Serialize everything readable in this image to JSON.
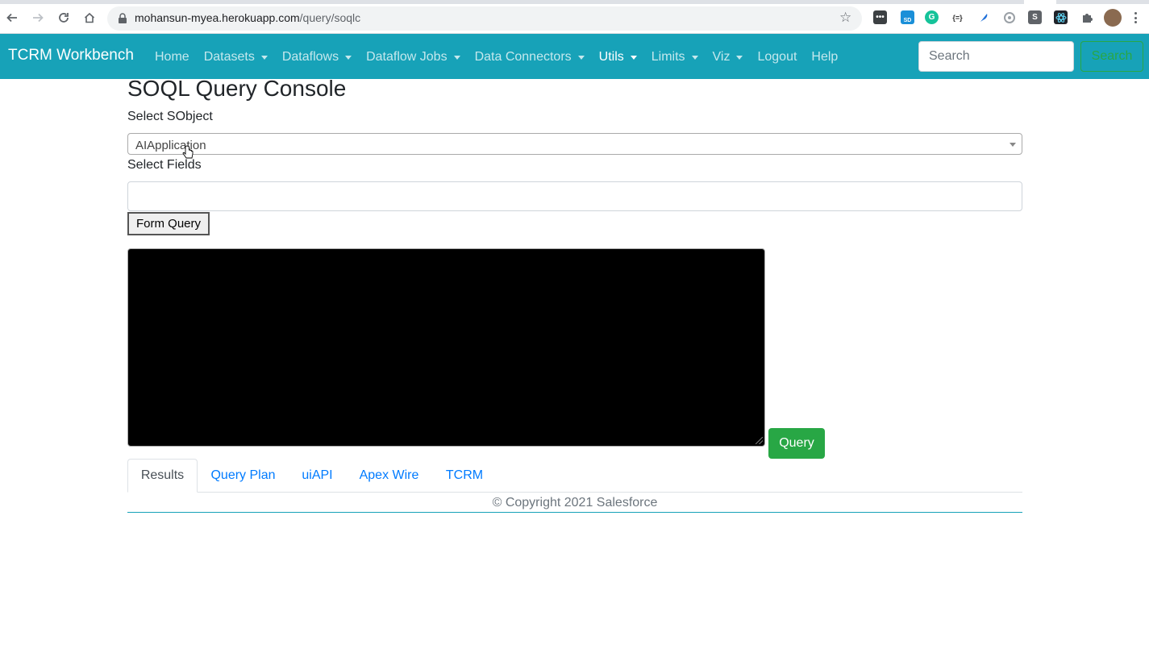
{
  "browser": {
    "url_host": "mohansun-myea.herokuapp.com",
    "url_path": "/query/soqlc",
    "extensions": [
      "extension-icon",
      "salesforce-icon",
      "grammarly-icon",
      "json-icon",
      "feather-icon",
      "gear-icon",
      "s-icon",
      "react-icon",
      "puzzle-icon"
    ],
    "ext_sd_badge": "SD",
    "ext_g": "G",
    "ext_json": "{=}",
    "ext_s": "S"
  },
  "navbar": {
    "brand": "TCRM Workbench",
    "items": [
      {
        "label": "Home",
        "dropdown": false
      },
      {
        "label": "Datasets",
        "dropdown": true
      },
      {
        "label": "Dataflows",
        "dropdown": true
      },
      {
        "label": "Dataflow Jobs",
        "dropdown": true
      },
      {
        "label": "Data Connectors",
        "dropdown": true
      },
      {
        "label": "Utils",
        "dropdown": true,
        "active": true
      },
      {
        "label": "Limits",
        "dropdown": true
      },
      {
        "label": "Viz",
        "dropdown": true
      },
      {
        "label": "Logout",
        "dropdown": false
      },
      {
        "label": "Help",
        "dropdown": false
      }
    ],
    "search_placeholder": "Search",
    "search_button": "Search"
  },
  "main": {
    "title": "SOQL Query Console",
    "select_sobject_label": "Select SObject",
    "select_sobject_value": "AIApplication",
    "select_fields_label": "Select Fields",
    "form_query_button": "Form Query",
    "query_button": "Query",
    "tabs": [
      {
        "label": "Results",
        "active": true
      },
      {
        "label": "Query Plan"
      },
      {
        "label": "uiAPI"
      },
      {
        "label": "Apex Wire"
      },
      {
        "label": "TCRM"
      }
    ],
    "footer": "© Copyright 2021 Salesforce"
  },
  "colors": {
    "navbar": "#17a2b8",
    "success": "#28a745",
    "link": "#007bff"
  }
}
